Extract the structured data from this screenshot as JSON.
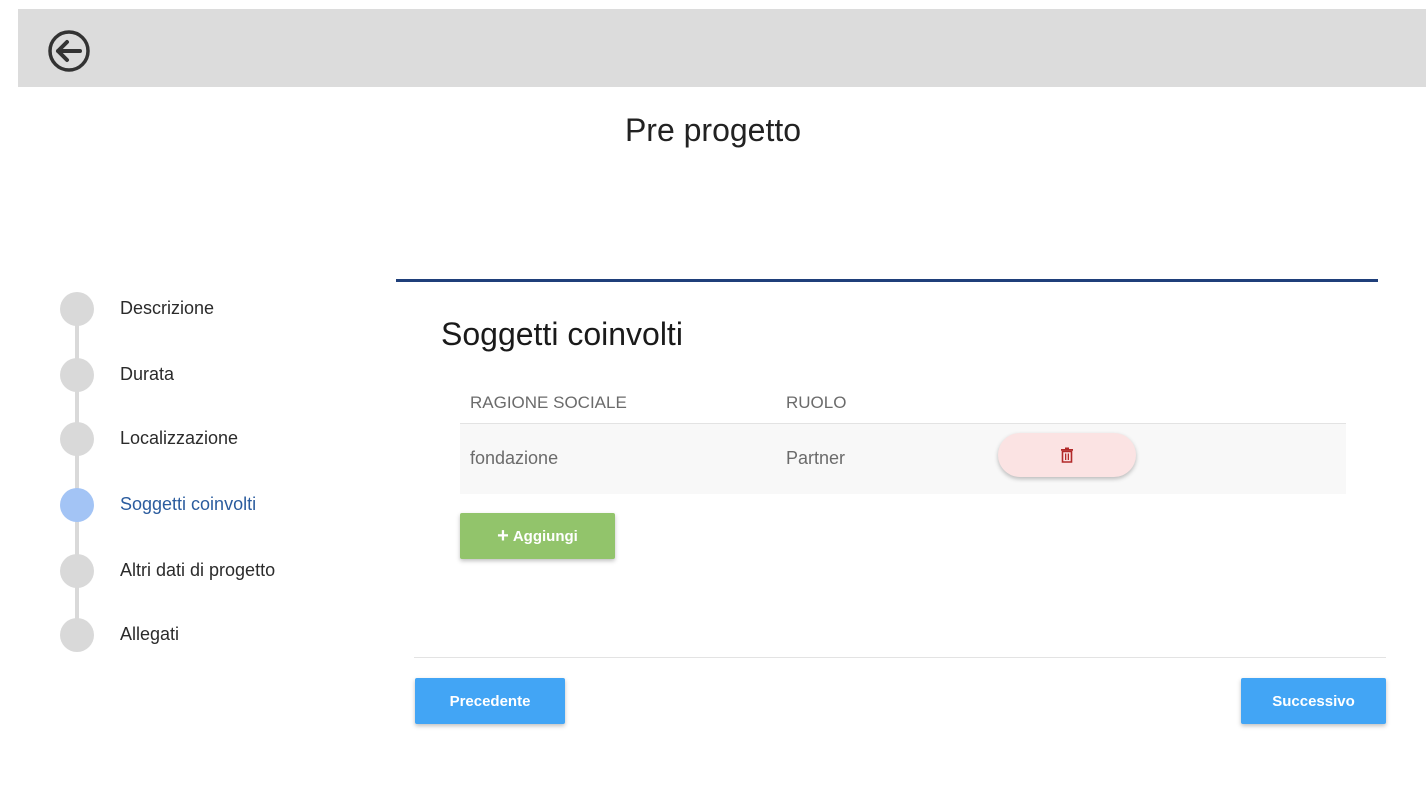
{
  "header": {
    "back_icon": "arrow-left-circle-icon"
  },
  "page": {
    "title": "Pre progetto"
  },
  "stepper": {
    "steps": [
      {
        "label": "Descrizione",
        "active": false
      },
      {
        "label": "Durata",
        "active": false
      },
      {
        "label": "Localizzazione",
        "active": false
      },
      {
        "label": "Soggetti coinvolti",
        "active": true
      },
      {
        "label": "Altri dati di progetto",
        "active": false
      },
      {
        "label": "Allegati",
        "active": false
      }
    ]
  },
  "section": {
    "title": "Soggetti coinvolti",
    "table": {
      "columns": [
        "RAGIONE SOCIALE",
        "RUOLO"
      ],
      "rows": [
        {
          "ragione_sociale": "fondazione",
          "ruolo": "Partner",
          "delete_icon": "trash-icon"
        }
      ]
    },
    "add_button": {
      "icon": "plus-icon",
      "label": "Aggiungi"
    }
  },
  "footer": {
    "prev_label": "Precedente",
    "next_label": "Successivo"
  },
  "colors": {
    "topbar": "#dcdcdc",
    "accent_rule": "#1f3f7a",
    "active_step": "#a3c4f5",
    "add_button": "#92c46b",
    "nav_button": "#42a5f5",
    "delete_button_bg": "#fbe3e3",
    "delete_icon": "#b22a2a"
  }
}
